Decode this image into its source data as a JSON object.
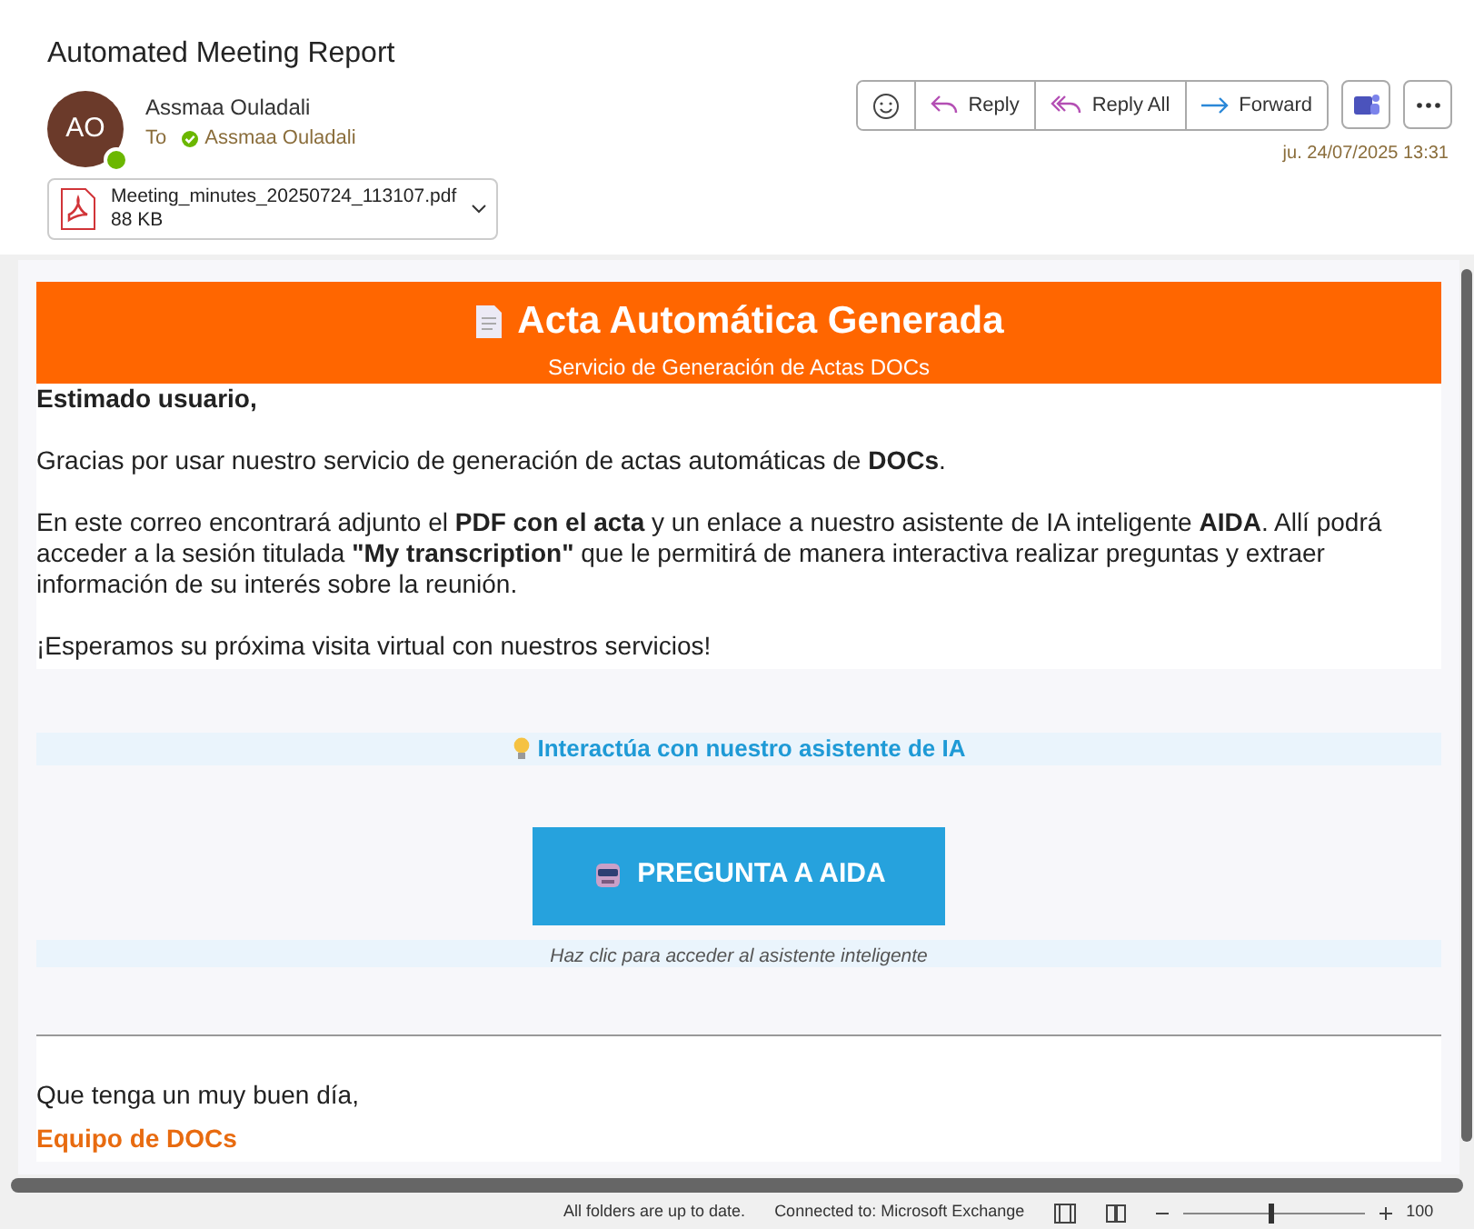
{
  "subject": "Automated Meeting Report",
  "sender": {
    "initials": "AO",
    "name": "Assmaa Ouladali",
    "online": true,
    "to_label": "To",
    "recipient": "Assmaa Ouladali"
  },
  "attachment": {
    "filename": "Meeting_minutes_20250724_113107.pdf",
    "size": "88 KB"
  },
  "actions": [
    {
      "kind": "emoji"
    },
    {
      "kind": "reply",
      "label": "Reply"
    },
    {
      "kind": "reply-all",
      "label": "Reply All"
    },
    {
      "kind": "forward",
      "label": "Forward"
    }
  ],
  "date": "ju. 24/07/2025 13:31",
  "email": {
    "banner_title": "Acta Automática Generada",
    "banner_subtitle": "Servicio de Generación de Actas DOCs",
    "greeting": "Estimado usuario,",
    "paragraphs": [
      "Gracias por usar nuestro servicio de generación de actas automáticas de **DOCs**.",
      "En este correo encontrará adjunto el **PDF con el acta** y un enlace a nuestro asistente de IA inteligente **AIDA**. Allí podrá acceder a la sesión titulada **\"My transcription\"** que le permitirá de manera interactiva realizar preguntas y extraer información de su interés sobre la reunión.",
      "¡Esperamos su próxima visita virtual con nuestros servicios!"
    ],
    "cta_heading": "Interactúa con nuestro asistente de IA",
    "cta_button": "PREGUNTA A AIDA",
    "cta_hint": "Haz clic para acceder al asistente inteligente",
    "closing": "Que tenga un muy buen día,",
    "signature": "Equipo de DOCs"
  },
  "status_bar": {
    "sync": "All folders are up to date.",
    "connection": "Connected to: Microsoft Exchange",
    "zoom": {
      "level": 0.47,
      "reading": "100"
    }
  }
}
